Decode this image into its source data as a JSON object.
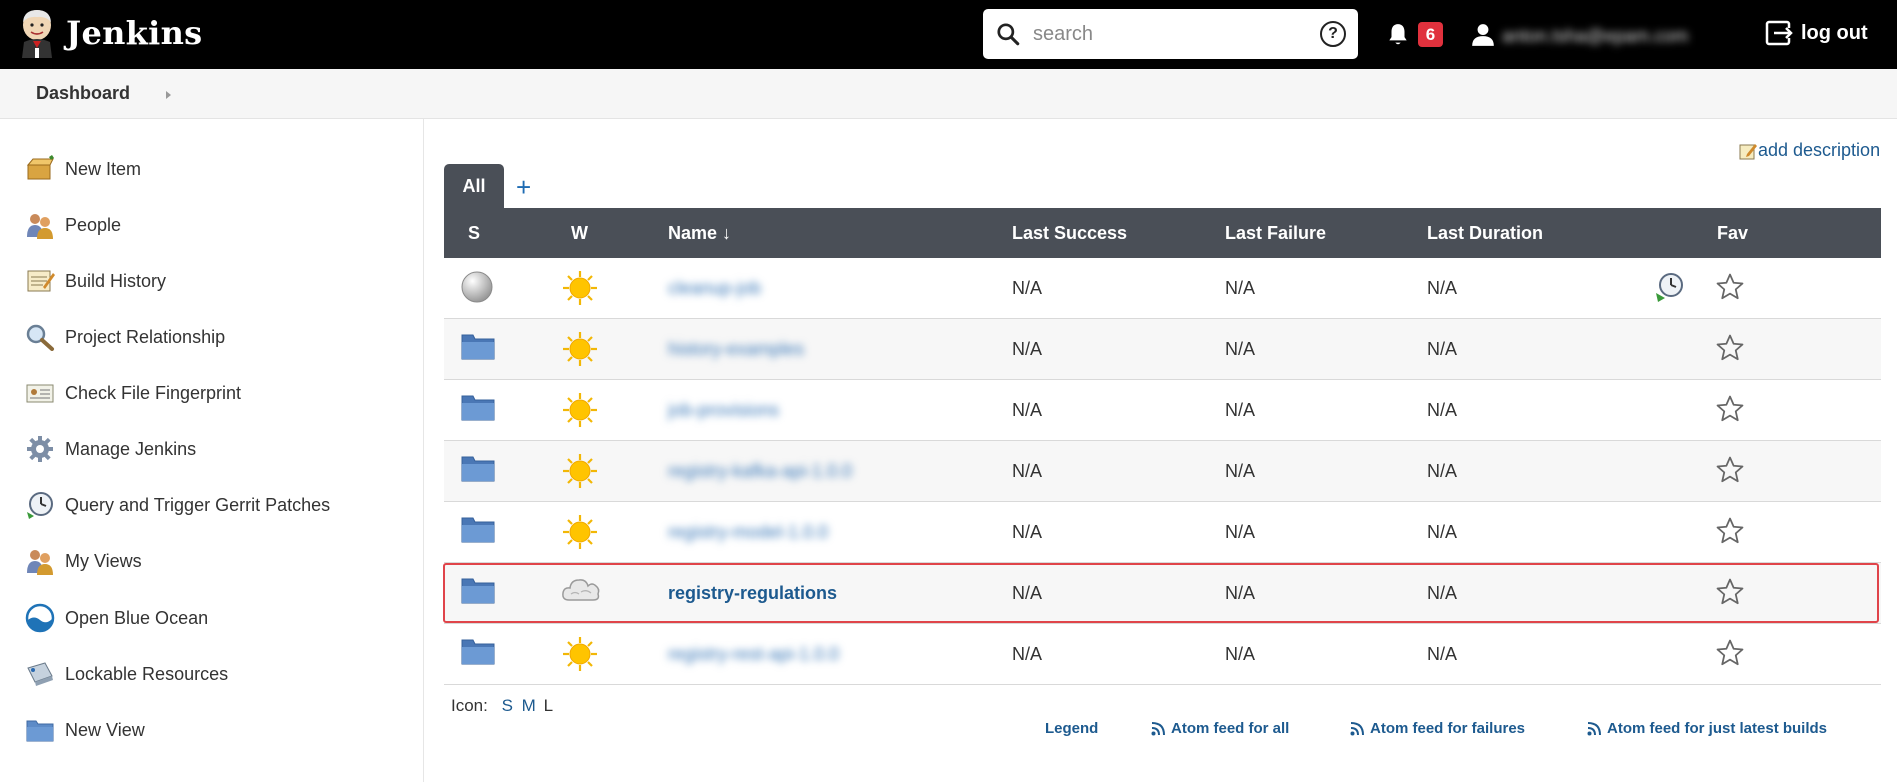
{
  "header": {
    "brand": "Jenkins",
    "search_placeholder": "search",
    "help_label": "?",
    "notification_count": "6",
    "user_name": "anton.tsha@epam.com",
    "logout_label": "log out"
  },
  "breadcrumb": {
    "dashboard": "Dashboard"
  },
  "sidebar": {
    "items": [
      {
        "label": "New Item",
        "icon": "new-item-icon"
      },
      {
        "label": "People",
        "icon": "people-icon"
      },
      {
        "label": "Build History",
        "icon": "notepad-icon"
      },
      {
        "label": "Project Relationship",
        "icon": "magnifier-icon"
      },
      {
        "label": "Check File Fingerprint",
        "icon": "fingerprint-icon"
      },
      {
        "label": "Manage Jenkins",
        "icon": "gear-icon"
      },
      {
        "label": "Query and Trigger Gerrit Patches",
        "icon": "clock-icon"
      },
      {
        "label": "My Views",
        "icon": "people-icon"
      },
      {
        "label": "Open Blue Ocean",
        "icon": "blue-ocean-icon"
      },
      {
        "label": "Lockable Resources",
        "icon": "lock-resource-icon"
      },
      {
        "label": "New View",
        "icon": "folder-icon"
      }
    ]
  },
  "main": {
    "add_description": "add description",
    "tabs": {
      "all": "All",
      "add": "+"
    },
    "columns": {
      "s": "S",
      "w": "W",
      "name": "Name ↓",
      "last_success": "Last Success",
      "last_failure": "Last Failure",
      "last_duration": "Last Duration",
      "fav": "Fav"
    },
    "rows": [
      {
        "name": "cleanup-job",
        "status_icon": "grey-ball-icon",
        "weather_icon": "sun-icon",
        "last_success": "N/A",
        "last_failure": "N/A",
        "last_duration": "N/A",
        "blurred": true,
        "schedule_icon": true
      },
      {
        "name": "history-examples",
        "status_icon": "folder-icon",
        "weather_icon": "sun-icon",
        "last_success": "N/A",
        "last_failure": "N/A",
        "last_duration": "N/A",
        "blurred": true
      },
      {
        "name": "job-provisions",
        "status_icon": "folder-icon",
        "weather_icon": "sun-icon",
        "last_success": "N/A",
        "last_failure": "N/A",
        "last_duration": "N/A",
        "blurred": true
      },
      {
        "name": "registry-kafka-api-1.0.0",
        "status_icon": "folder-icon",
        "weather_icon": "sun-icon",
        "last_success": "N/A",
        "last_failure": "N/A",
        "last_duration": "N/A",
        "blurred": true
      },
      {
        "name": "registry-model-1.0.0",
        "status_icon": "folder-icon",
        "weather_icon": "sun-icon",
        "last_success": "N/A",
        "last_failure": "N/A",
        "last_duration": "N/A",
        "blurred": true
      },
      {
        "name": "registry-regulations",
        "status_icon": "folder-icon",
        "weather_icon": "cloud-icon",
        "last_success": "N/A",
        "last_failure": "N/A",
        "last_duration": "N/A",
        "blurred": false
      },
      {
        "name": "registry-rest-api-1.0.0",
        "status_icon": "folder-icon",
        "weather_icon": "sun-icon",
        "last_success": "N/A",
        "last_failure": "N/A",
        "last_duration": "N/A",
        "blurred": true
      }
    ],
    "icon_size": {
      "label": "Icon:",
      "s": "S",
      "m": "M",
      "l": "L"
    },
    "footer": {
      "legend": "Legend",
      "feed_all": "Atom feed for all",
      "feed_failures": "Atom feed for failures",
      "feed_latest": "Atom feed for just latest builds"
    }
  },
  "colors": {
    "header_bg": "#000000",
    "table_header_bg": "#4a4f57",
    "link": "#1d5a8f",
    "badge": "#e0313d",
    "highlight": "#e0444a"
  }
}
